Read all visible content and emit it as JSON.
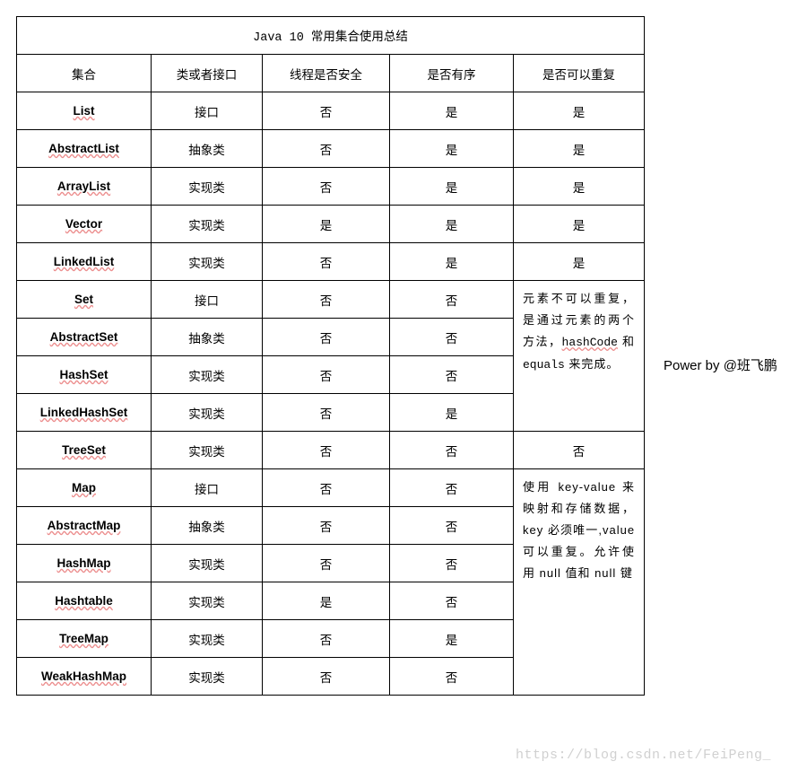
{
  "title": "Java 10 常用集合使用总结",
  "headers": {
    "c0": "集合",
    "c1": "类或者接口",
    "c2": "线程是否安全",
    "c3": "是否有序",
    "c4": "是否可以重复"
  },
  "rows": {
    "list": {
      "name": "List",
      "type": "接口",
      "safe": "否",
      "ordered": "是",
      "dup": "是"
    },
    "abstractList": {
      "name": "AbstractList",
      "type": "抽象类",
      "safe": "否",
      "ordered": "是",
      "dup": "是"
    },
    "arrayList": {
      "name": "ArrayList",
      "type": "实现类",
      "safe": "否",
      "ordered": "是",
      "dup": "是"
    },
    "vector": {
      "name": "Vector",
      "type": "实现类",
      "safe": "是",
      "ordered": "是",
      "dup": "是"
    },
    "linkedList": {
      "name": "LinkedList",
      "type": "实现类",
      "safe": "否",
      "ordered": "是",
      "dup": "是"
    },
    "set": {
      "name": "Set",
      "type": "接口",
      "safe": "否",
      "ordered": "否"
    },
    "abstractSet": {
      "name": "AbstractSet",
      "type": "抽象类",
      "safe": "否",
      "ordered": "否"
    },
    "hashSet": {
      "name": "HashSet",
      "type": "实现类",
      "safe": "否",
      "ordered": "否"
    },
    "linkedHashSet": {
      "name": "LinkedHashSet",
      "type": "实现类",
      "safe": "否",
      "ordered": "是"
    },
    "treeSet": {
      "name": "TreeSet",
      "type": "实现类",
      "safe": "否",
      "ordered": "否",
      "dup": "否"
    },
    "map": {
      "name": "Map",
      "type": "接口",
      "safe": "否",
      "ordered": "否"
    },
    "abstractMap": {
      "name": "AbstractMap",
      "type": "抽象类",
      "safe": "否",
      "ordered": "否"
    },
    "hashMap": {
      "name": "HashMap",
      "type": "实现类",
      "safe": "否",
      "ordered": "否"
    },
    "hashtable": {
      "name": "Hashtable",
      "type": "实现类",
      "safe": "是",
      "ordered": "否"
    },
    "treeMap": {
      "name": "TreeMap",
      "type": "实现类",
      "safe": "否",
      "ordered": "是"
    },
    "weakHashMap": {
      "name": "WeakHashMap",
      "type": "实现类",
      "safe": "否",
      "ordered": "否"
    }
  },
  "notes": {
    "set_prefix": "元素不可以重复，是通过元素的两个方法，",
    "set_code1": "hashCode",
    "set_mid": " 和 ",
    "set_code2": "equals",
    "set_suffix": " 来完成。",
    "map_text": "使用 key-value 来映射和存储数据，key 必须唯一,value 可以重复。允许使用 null 值和 null 键"
  },
  "powerby": "Power by @班飞鹏",
  "watermark": "https://blog.csdn.net/FeiPeng_"
}
